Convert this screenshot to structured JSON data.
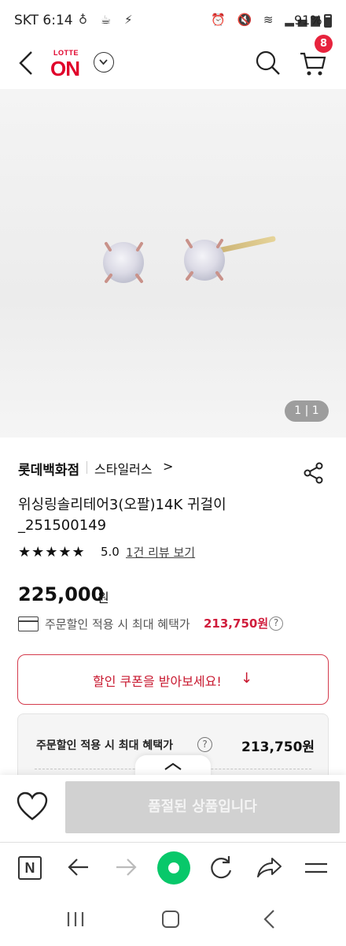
{
  "status_bar": {
    "time": "SKT 6:14",
    "battery": "91%"
  },
  "header": {
    "logo_top": "LOTTE",
    "logo_main": "ON",
    "cart_count": "8",
    "brand_color": "#e0002a"
  },
  "gallery": {
    "counter": "1 | 1"
  },
  "product": {
    "store": "롯데백화점",
    "brand": "스타일러스",
    "brand_chevron": ">",
    "title_line1": "위싱링솔리테어3(오팔)14K 귀걸이",
    "title_line2": "_251500149",
    "stars": "★★★★★",
    "rating": "5.0",
    "review_link": "1건 리뷰 보기",
    "price": "225,000",
    "price_unit": "원",
    "discount_text": "주문할인 적용 시 최대 혜택가",
    "discount_amount": "213,750원",
    "help_symbol": "?"
  },
  "coupon": {
    "label": "할인 쿠폰을 받아보세요!",
    "arrow": "↓",
    "accent_color": "#c8182f"
  },
  "benefit": {
    "label": "주문할인 적용 시 최대 혜택가",
    "amount": "213,750원"
  },
  "buy_bar": {
    "soldout_label": "품절된 상품입니다"
  },
  "browser": {
    "n_label": "N",
    "accent_green": "#08c86a"
  }
}
